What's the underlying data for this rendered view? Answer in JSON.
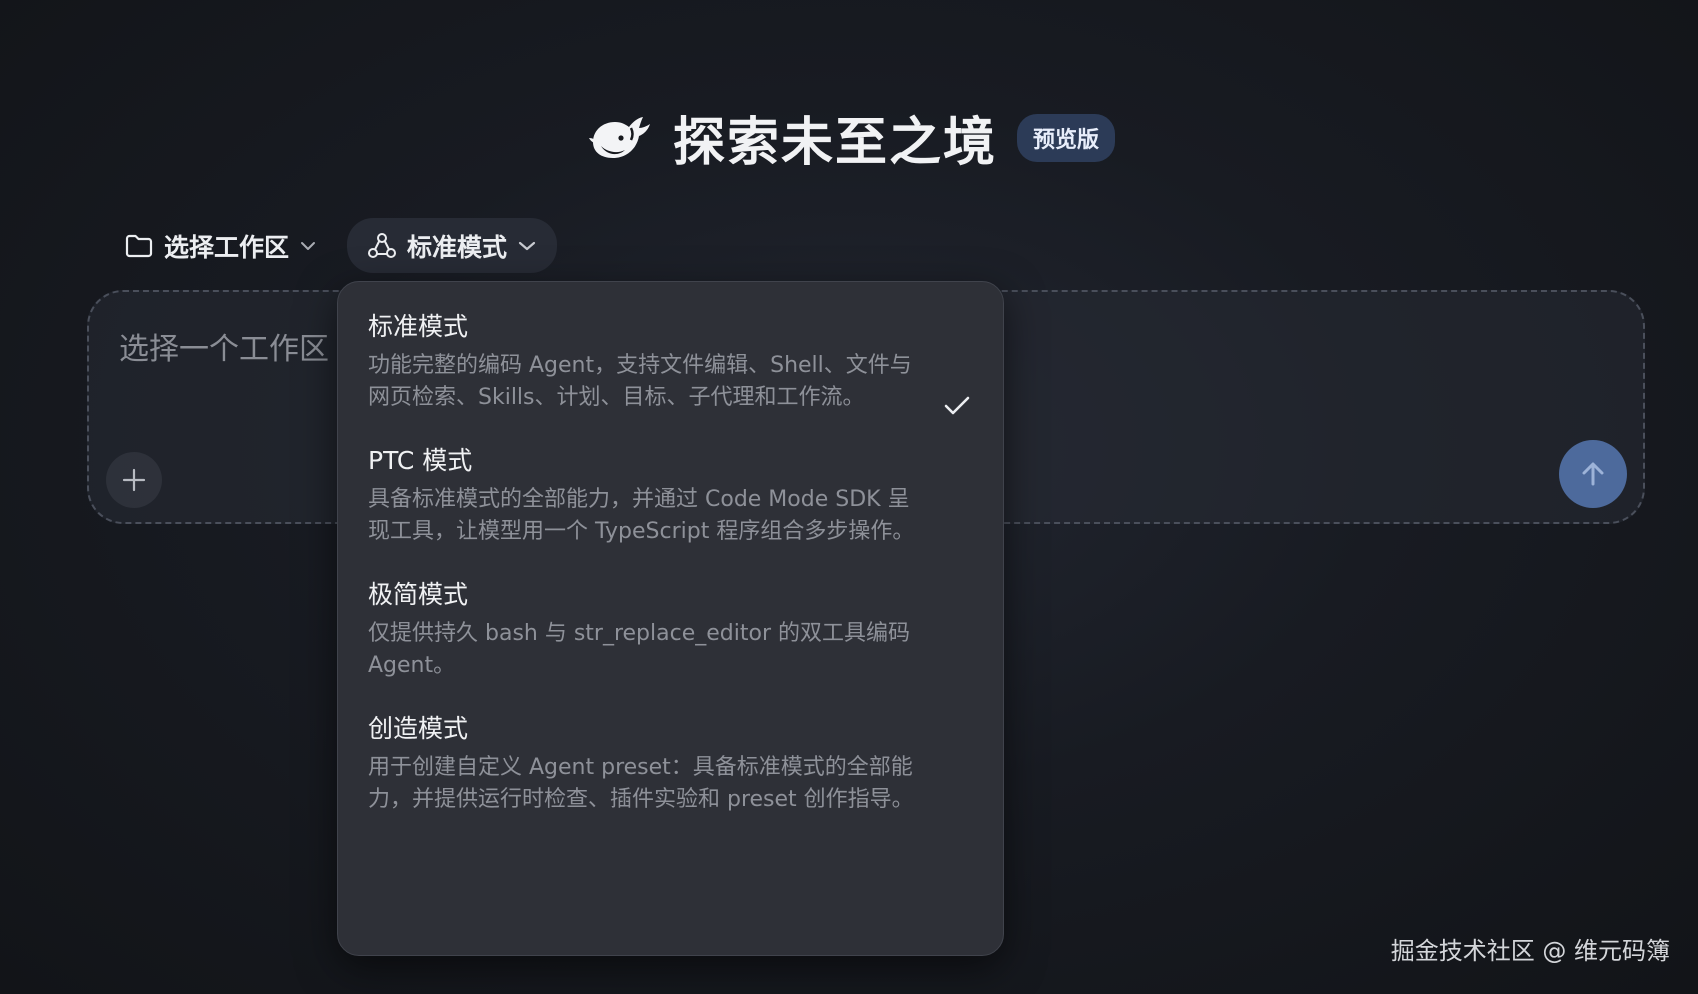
{
  "header": {
    "title": "探索未至之境",
    "badge": "预览版"
  },
  "toolbar": {
    "workspace_label": "选择工作区",
    "mode_label": "标准模式"
  },
  "composer": {
    "placeholder": "选择一个工作区"
  },
  "mode_menu": {
    "options": [
      {
        "title": "标准模式",
        "description": "功能完整的编码 Agent，支持文件编辑、Shell、文件与网页检索、Skills、计划、目标、子代理和工作流。",
        "selected": true
      },
      {
        "title": "PTC 模式",
        "description": "具备标准模式的全部能力，并通过 Code Mode SDK 呈现工具，让模型用一个 TypeScript 程序组合多步操作。",
        "selected": false
      },
      {
        "title": "极简模式",
        "description": "仅提供持久 bash 与 str_replace_editor 的双工具编码 Agent。",
        "selected": false
      },
      {
        "title": "创造模式",
        "description": "用于创建自定义 Agent preset：具备标准模式的全部能力，并提供运行时检查、插件实验和 preset 创作指导。",
        "selected": false
      }
    ]
  },
  "watermark": "掘金技术社区 @ 维元码簿",
  "icons": {
    "logo": "whale-logo-icon",
    "workspace": "folder-icon",
    "mode": "mode-nodes-icon",
    "chevron": "chevron-down-icon",
    "add": "plus-icon",
    "send": "arrow-up-icon",
    "check": "check-icon"
  },
  "colors": {
    "accent": "#4d6a9c",
    "badge_bg": "#2c3b57",
    "menu_bg": "#2e3037"
  }
}
